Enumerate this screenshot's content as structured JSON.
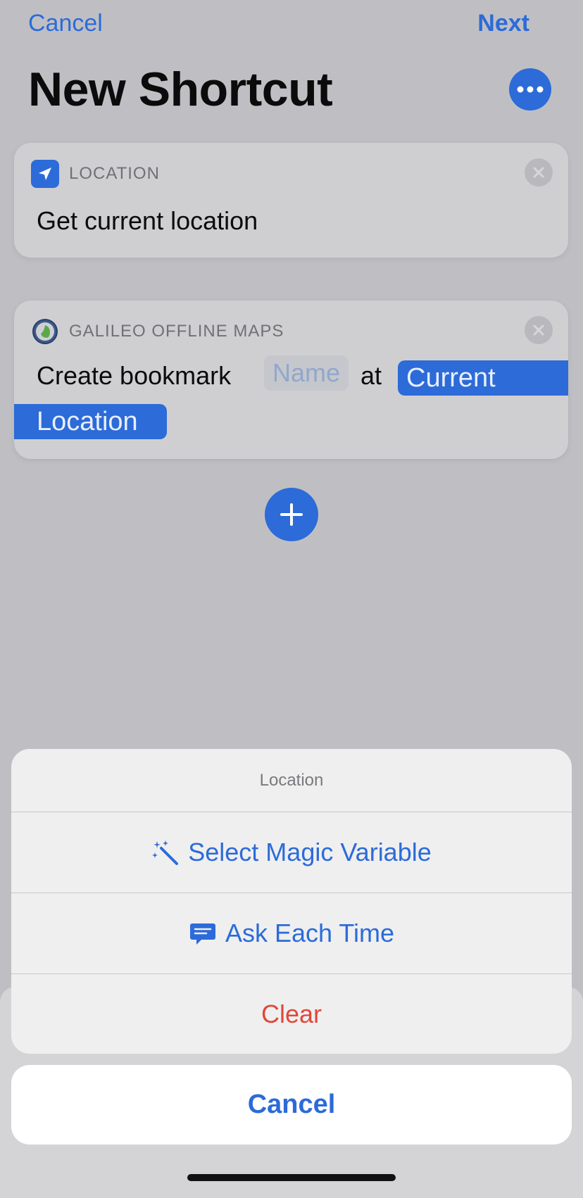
{
  "nav": {
    "cancel_label": "Cancel",
    "next_label": "Next"
  },
  "page": {
    "title": "New Shortcut"
  },
  "actions": [
    {
      "category": "LOCATION",
      "text": "Get current location"
    },
    {
      "category": "GALILEO OFFLINE MAPS",
      "text_prefix": "Create bookmark",
      "name_placeholder": "Name",
      "text_middle": "at",
      "variable_line1": "Current",
      "variable_line2": "Location"
    }
  ],
  "action_sheet": {
    "title": "Location",
    "options": [
      {
        "label": "Select Magic Variable",
        "icon": "magic-wand-icon"
      },
      {
        "label": "Ask Each Time",
        "icon": "speech-bubble-icon"
      },
      {
        "label": "Clear"
      }
    ],
    "cancel_label": "Cancel"
  },
  "colors": {
    "accent": "#2c6bd8",
    "destructive": "#e0483a"
  }
}
